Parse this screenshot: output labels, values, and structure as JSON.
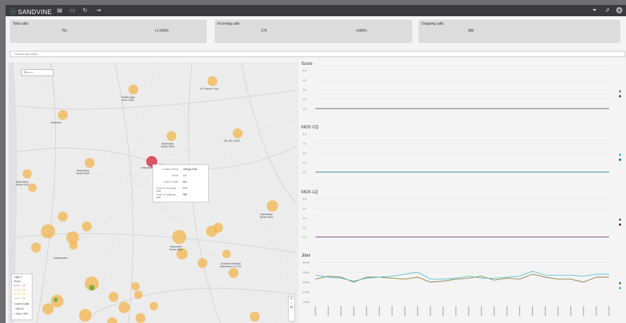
{
  "topbar": {
    "brand": "SANDVINE",
    "icons": [
      "dashboard-icon",
      "bookmark-icon",
      "history-icon",
      "export-icon"
    ],
    "right_icons": [
      "filter-icon",
      "share-icon",
      "user-icon"
    ]
  },
  "kpis": [
    {
      "title": "Total calls",
      "value": "761",
      "change": "+1 000%"
    },
    {
      "title": "Incoming calls",
      "value": "276",
      "change": "+999%"
    },
    {
      "title": "Outgoing calls",
      "value": "385",
      "change": ""
    }
  ],
  "search": {
    "placeholder": "Search Geo-Shell"
  },
  "map": {
    "search_placeholder": "Search",
    "tooltip": {
      "rows": [
        {
          "key": "Location Name",
          "value": "Jelenga East"
        },
        {
          "key": "Score",
          "value": "1.6"
        },
        {
          "key": "Count of calls",
          "value": "661"
        },
        {
          "key": "Count of incoming calls",
          "value": "276"
        },
        {
          "key": "Count of outgoing calls",
          "value": "385"
        }
      ]
    },
    "legend": {
      "title1": "Layer 1",
      "title2": "Score",
      "items": [
        "0.0 - 1.0",
        "1.0 - 2.0",
        "2.0 - 3.0",
        "3.0 - 4.0"
      ],
      "size_title": "Count of calls",
      "size_items": [
        "Min 10",
        "Max 1,000"
      ]
    },
    "zoom_in": "+",
    "zoom_out": "−"
  },
  "charts": {
    "titles": [
      "Score",
      "MOS CQ",
      "MOS LQ",
      "Jitter"
    ],
    "score_ticks": [
      "5.0",
      "4.0",
      "3.0",
      "2.0",
      "1.0"
    ],
    "jitter_ticks": [
      "50 ms",
      "40 ms",
      "30 ms",
      "20 ms",
      "10 ms"
    ]
  },
  "chart_data": [
    {
      "type": "line",
      "title": "Score",
      "ylim": [
        1,
        5
      ],
      "series": [
        {
          "values": [
            1.0,
            1.0,
            1.0,
            1.0,
            1.0,
            1.0,
            1.0,
            1.0,
            1.0,
            1.0,
            1.0,
            1.0,
            1.0,
            1.0,
            1.0,
            1.0,
            1.0,
            1.0,
            1.0,
            1.0,
            1.0,
            1.0,
            1.0,
            1.0
          ]
        },
        {
          "values": [
            1.0,
            1.0,
            1.0,
            1.0,
            1.0,
            1.0,
            1.0,
            1.0,
            1.0,
            1.0,
            1.0,
            1.0,
            1.0,
            1.0,
            1.0,
            1.0,
            1.0,
            1.0,
            1.0,
            1.0,
            1.0,
            1.0,
            1.0,
            1.0
          ]
        }
      ]
    },
    {
      "type": "line",
      "title": "MOS CQ",
      "ylim": [
        1,
        5
      ],
      "series": [
        {
          "values": [
            1.0,
            1.0,
            1.0,
            1.0,
            1.0,
            1.0,
            1.0,
            1.0,
            1.0,
            1.0,
            1.0,
            1.0,
            1.0,
            1.0,
            1.0,
            1.0,
            1.0,
            1.0,
            1.0,
            1.0,
            1.0,
            1.0,
            1.0,
            1.0
          ]
        },
        {
          "values": [
            1.0,
            1.0,
            1.0,
            1.0,
            1.0,
            1.0,
            1.0,
            1.0,
            1.0,
            1.0,
            1.0,
            1.0,
            1.0,
            1.0,
            1.0,
            1.0,
            1.0,
            1.0,
            1.0,
            1.0,
            1.0,
            1.0,
            1.0,
            1.0
          ]
        }
      ]
    },
    {
      "type": "line",
      "title": "MOS LQ",
      "ylim": [
        1,
        5
      ],
      "series": [
        {
          "values": [
            1.0,
            1.0,
            1.0,
            1.0,
            1.0,
            1.0,
            1.0,
            1.0,
            1.0,
            1.0,
            1.0,
            1.0,
            1.0,
            1.0,
            1.0,
            1.0,
            1.0,
            1.0,
            1.0,
            1.0,
            1.0,
            1.0,
            1.0,
            1.0
          ]
        },
        {
          "values": [
            1.0,
            1.0,
            1.0,
            1.0,
            1.0,
            1.0,
            1.0,
            1.0,
            1.0,
            1.0,
            1.0,
            1.0,
            1.0,
            1.0,
            1.0,
            1.0,
            1.0,
            1.0,
            1.0,
            1.0,
            1.0,
            1.0,
            1.0,
            1.0
          ]
        }
      ]
    },
    {
      "type": "line",
      "title": "Jitter",
      "ylim": [
        10,
        50
      ],
      "series": [
        {
          "values": [
            33,
            36,
            35,
            30,
            35,
            35,
            34,
            33,
            35,
            30,
            31,
            33,
            34,
            36,
            32,
            34,
            33,
            38,
            35,
            33,
            33,
            30,
            35,
            35
          ]
        },
        {
          "values": [
            37,
            35,
            34,
            31,
            34,
            35,
            36,
            38,
            40,
            33,
            33,
            34,
            36,
            34,
            34,
            35,
            36,
            41,
            37,
            37,
            37,
            36,
            38,
            38
          ]
        }
      ]
    }
  ],
  "colors": {
    "score": "#888888",
    "mos_cq": "#4fb8d6",
    "mos_lq": "#9c4f9c",
    "jitter_a": "#8a7a3c",
    "jitter_b": "#4fc0c8"
  }
}
